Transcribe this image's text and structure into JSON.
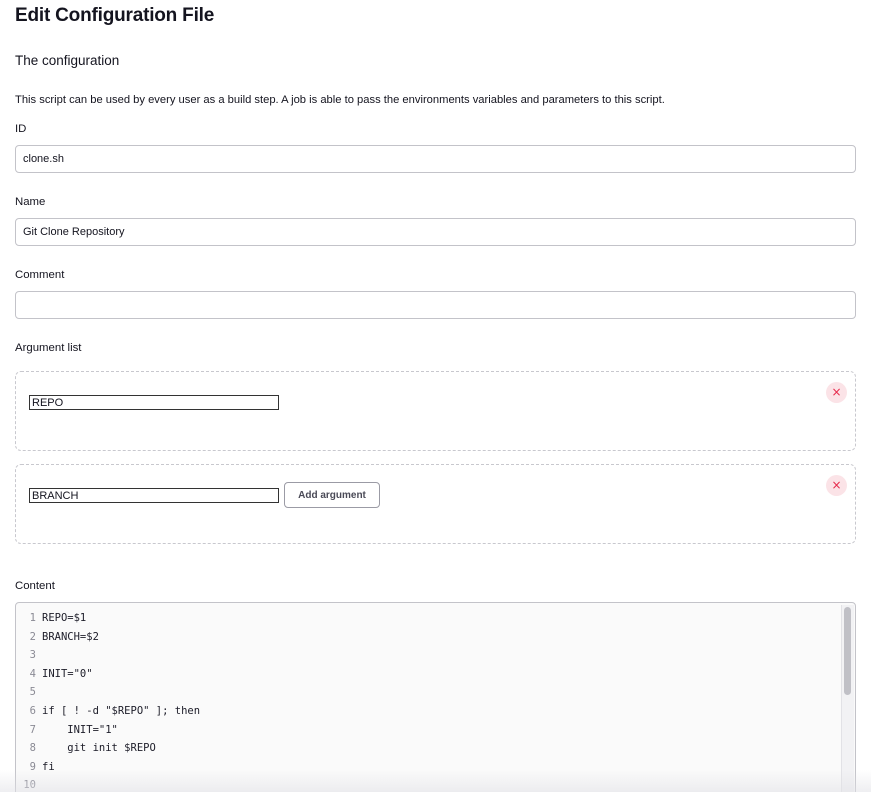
{
  "page": {
    "title": "Edit Configuration File",
    "section_title": "The configuration",
    "description": "This script can be used by every user as a build step. A job is able to pass the environments variables and parameters to this script."
  },
  "fields": {
    "id": {
      "label": "ID",
      "value": "clone.sh"
    },
    "name": {
      "label": "Name",
      "value": "Git Clone Repository"
    },
    "comment": {
      "label": "Comment",
      "value": ""
    },
    "argument_list": {
      "label": "Argument list",
      "items": [
        {
          "value": "REPO"
        },
        {
          "value": "BRANCH"
        }
      ],
      "add_button_label": "Add argument",
      "delete_icon": "×"
    },
    "content": {
      "label": "Content",
      "lines": [
        {
          "num": "1",
          "text": "REPO=$1"
        },
        {
          "num": "2",
          "text": "BRANCH=$2"
        },
        {
          "num": "3",
          "text": ""
        },
        {
          "num": "4",
          "text": "INIT=\"0\""
        },
        {
          "num": "5",
          "text": ""
        },
        {
          "num": "6",
          "text": "if [ ! -d \"$REPO\" ]; then"
        },
        {
          "num": "7",
          "text": "    INIT=\"1\""
        },
        {
          "num": "8",
          "text": "    git init $REPO"
        },
        {
          "num": "9",
          "text": "fi"
        },
        {
          "num": "10",
          "text": ""
        }
      ]
    }
  },
  "colors": {
    "delete_icon": "#e6284a",
    "delete_bg": "#fbe3e7",
    "border": "#c3c3c9"
  }
}
